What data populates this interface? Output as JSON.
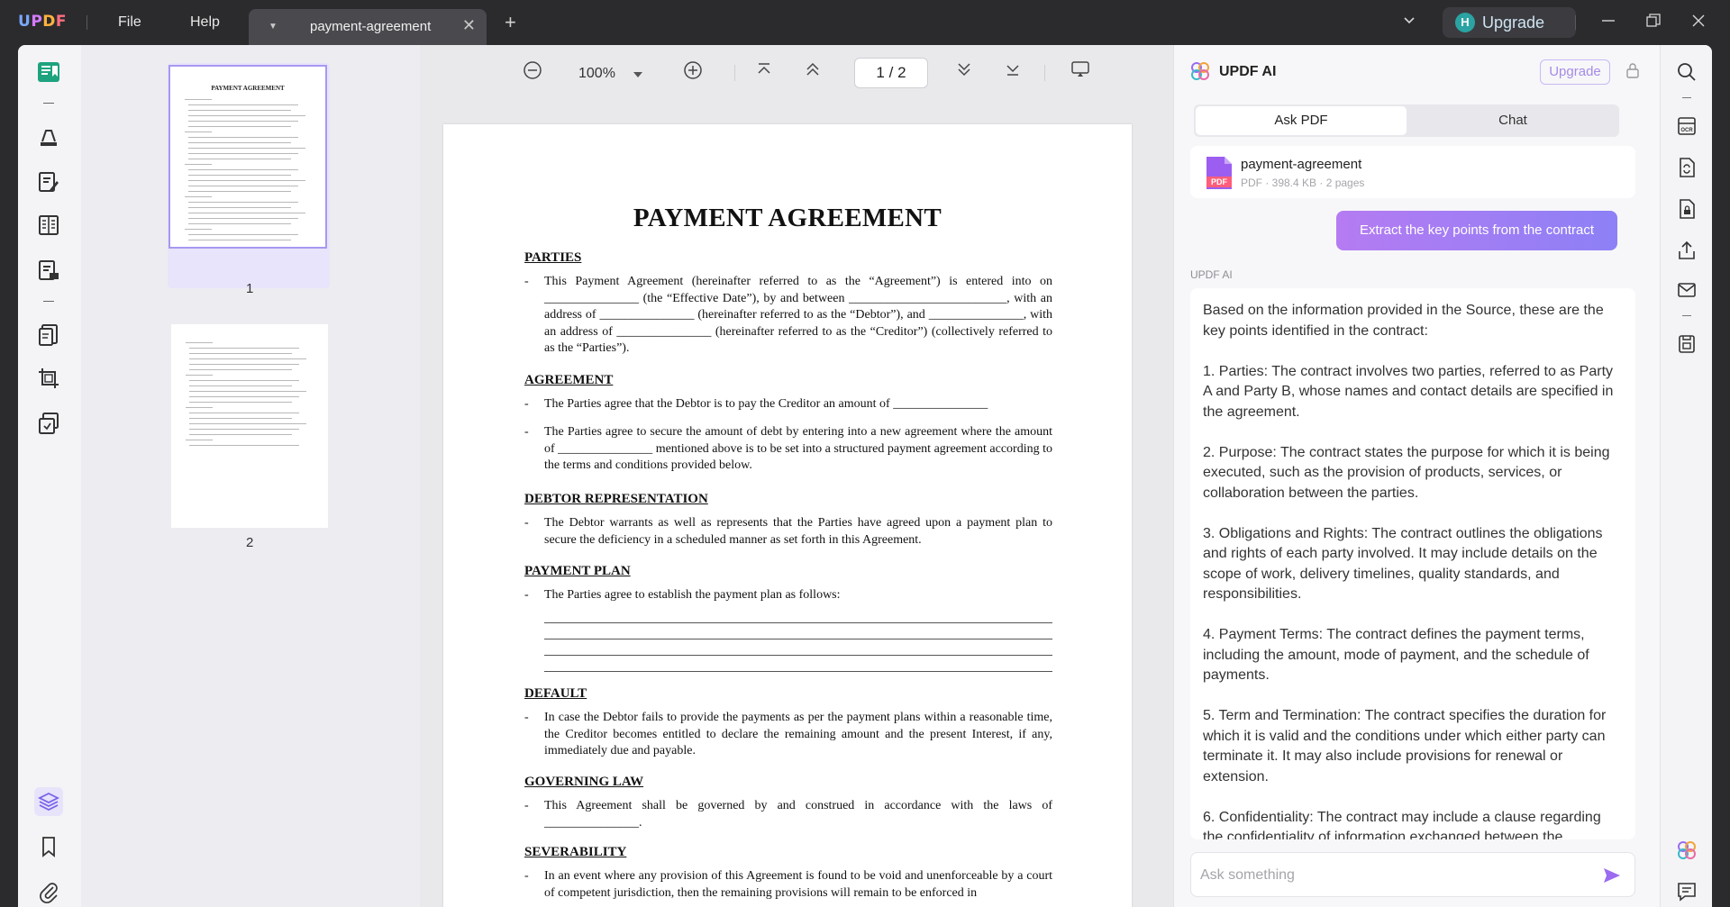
{
  "app": {
    "logo": "UPDF",
    "menu": {
      "file": "File",
      "help": "Help"
    },
    "tab_title": "payment-agreement",
    "tab_add": "+",
    "user_initial": "H",
    "upgrade_label": "Upgrade"
  },
  "toolbar": {
    "zoom": "100%",
    "current_page": "1",
    "page_sep": "/",
    "total_pages": "2"
  },
  "thumbnails": [
    {
      "number": "1",
      "title": "PAYMENT AGREEMENT"
    },
    {
      "number": "2"
    }
  ],
  "document": {
    "title": "PAYMENT AGREEMENT",
    "sections": [
      {
        "heading": "PARTIES",
        "items": [
          "This Payment Agreement (hereinafter referred to as the “Agreement”) is entered into on _______________ (the “Effective Date”), by and between _________________________, with an address of _______________ (hereinafter referred to as the “Debtor”), and _______________, with an address of _______________ (hereinafter referred to as the “Creditor”) (collectively referred to as the “Parties”)."
        ]
      },
      {
        "heading": "AGREEMENT",
        "items": [
          "The Parties agree that the Debtor is to pay the Creditor an amount of _______________",
          "The Parties agree to secure the amount of debt by entering into a new agreement where the amount of _______________ mentioned above is to be set into a structured payment agreement according to the terms and conditions provided below."
        ]
      },
      {
        "heading": "DEBTOR REPRESENTATION",
        "items": [
          "The Debtor warrants as well as represents that the Parties have agreed upon a payment plan to secure the deficiency in a scheduled manner as set forth in this Agreement."
        ]
      },
      {
        "heading": "PAYMENT PLAN",
        "items": [
          "The Parties agree to establish the payment plan as follows:"
        ]
      },
      {
        "heading": "DEFAULT",
        "items": [
          "In case the Debtor fails to provide the payments as per the payment plans within a reasonable time, the Creditor becomes entitled to declare the remaining amount and the present Interest, if any, immediately due and payable."
        ]
      },
      {
        "heading": "GOVERNING LAW",
        "items": [
          "This Agreement shall be governed by and construed in accordance with the laws of _______________."
        ]
      },
      {
        "heading": "SEVERABILITY",
        "items": [
          "In an event where any provision of this Agreement is found to be void and unenforceable by a court of competent jurisdiction, then the remaining provisions will remain to be enforced in"
        ]
      }
    ]
  },
  "ai_panel": {
    "title": "UPDF AI",
    "upgrade_label": "Upgrade",
    "tabs": {
      "ask_pdf": "Ask PDF",
      "chat": "Chat"
    },
    "file": {
      "name": "payment-agreement",
      "meta": "PDF · 398.4 KB · 2 pages",
      "icon_label": "PDF"
    },
    "user_message": "Extract the key points from the contract",
    "assistant_label": "UPDF AI",
    "answer": [
      "Based on the information provided in the Source, these are the key points identified in the contract:",
      "1. Parties: The contract involves two parties, referred to as Party A and Party B, whose names and contact details are specified in the agreement.",
      "2. Purpose: The contract states the purpose for which it is being executed, such as the provision of products, services, or collaboration between the parties.",
      "3. Obligations and Rights: The contract outlines the obligations and rights of each party involved. It may include details on the scope of work, delivery timelines, quality standards, and responsibilities.",
      "4. Payment Terms: The contract defines the payment terms, including the amount, mode of payment, and the schedule of payments.",
      "5. Term and Termination: The contract specifies the duration for which it is valid and the conditions under which either party can terminate it. It may also include provisions for renewal or extension.",
      "6. Confidentiality: The contract may include a clause regarding the confidentiality of information exchanged between the"
    ],
    "input_placeholder": "Ask something"
  },
  "colors": {
    "accent": "#8d80f6",
    "ai_gradient_start": "#b57bf2",
    "chrome": "#2b2b2d"
  }
}
